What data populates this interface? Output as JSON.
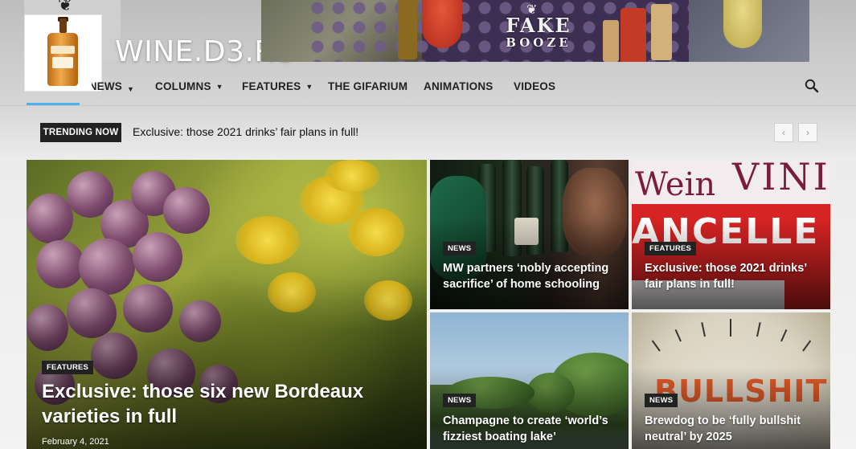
{
  "site": {
    "title": "WINE.D3.RU",
    "banner_brand_line1": "FAKE",
    "banner_brand_line2": "BOOZE"
  },
  "nav": {
    "items": [
      {
        "label": "NEWS",
        "has_dropdown": true,
        "active": true
      },
      {
        "label": "COLUMNS",
        "has_dropdown": true
      },
      {
        "label": "FEATURES",
        "has_dropdown": true
      },
      {
        "label": "THE GIFARIUM",
        "has_dropdown": false
      },
      {
        "label": "ANIMATIONS",
        "has_dropdown": false
      },
      {
        "label": "VIDEOS",
        "has_dropdown": false
      }
    ],
    "search_icon": "search-icon",
    "dropdown_icon": "chevron-down-icon",
    "active_color": "#4db2ec"
  },
  "trending": {
    "label": "TRENDING NOW",
    "headline": "Exclusive: those 2021 drinks’ fair plans in full!",
    "prev_icon": "‹",
    "next_icon": "›"
  },
  "tiles": [
    {
      "category": "FEATURES",
      "title": "Exclusive: those six new Bordeaux varieties in full",
      "date": "February 4, 2021"
    },
    {
      "category": "NEWS",
      "title": "MW partners ‘nobly accepting sacrifice’ of home schooling"
    },
    {
      "category": "FEATURES",
      "title": "Exclusive: those 2021 drinks’ fair plans in full!"
    },
    {
      "category": "NEWS",
      "title": "Champagne to create ‘world’s fizziest boating lake’"
    },
    {
      "category": "NEWS",
      "title": "Brewdog to be ‘fully bullshit neutral’ by 2025"
    }
  ]
}
